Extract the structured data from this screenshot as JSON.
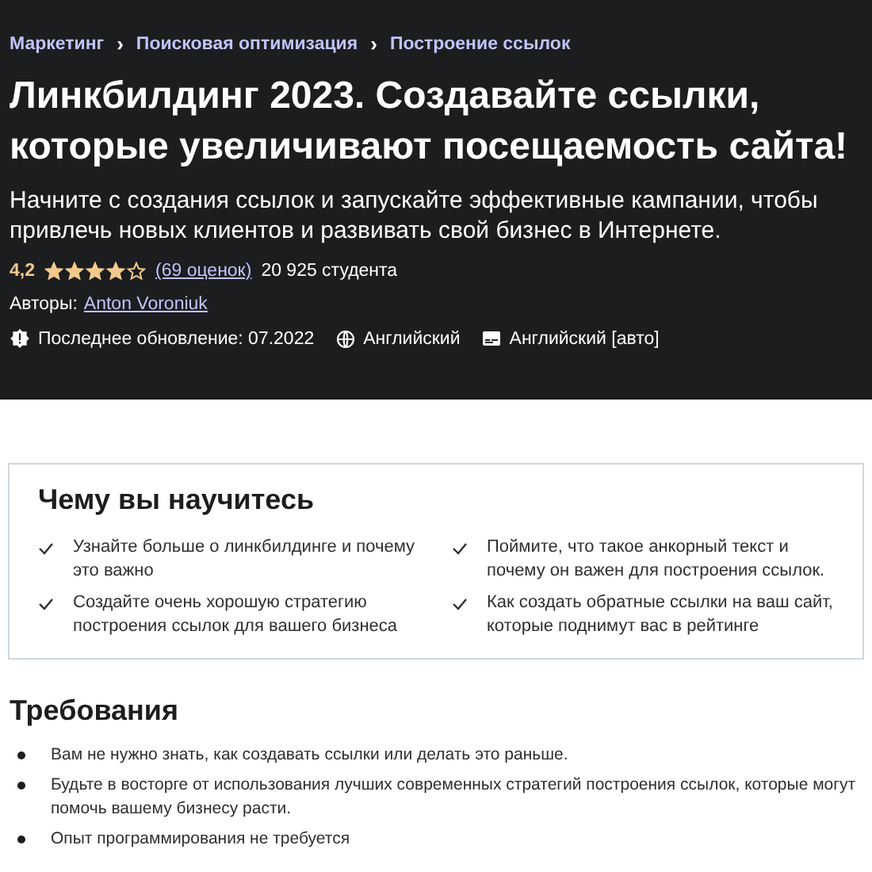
{
  "breadcrumbs": [
    {
      "label": "Маркетинг"
    },
    {
      "label": "Поисковая оптимизация"
    },
    {
      "label": "Построение ссылок"
    }
  ],
  "separator": "›",
  "title": "Линкбилдинг 2023. Создавайте ссылки, которые увеличивают посещаемость сайта!",
  "subtitle": "Начните с создания ссылок и запускайте эффективные кампании, чтобы привлечь новых клиентов и развивать свой бизнес в Интернете.",
  "rating": {
    "value": "4,2",
    "stars": 4,
    "reviews": "(69 оценок)",
    "students": "20 925 студента"
  },
  "authors": {
    "label": "Авторы:",
    "name": "Anton Voroniuk"
  },
  "meta": [
    {
      "kind": "updated",
      "text": "Последнее обновление: 07.2022"
    },
    {
      "kind": "language",
      "text": "Английский"
    },
    {
      "kind": "captions",
      "text": "Английский [авто]"
    }
  ],
  "learn": {
    "title": "Чему вы научитесь",
    "items": [
      "Узнайте больше о линкбилдинге и почему это важно",
      "Поймите, что такое анкорный текст и почему он важен для построения ссылок.",
      "Создайте очень хорошую стратегию построения ссылок для вашего бизнеса",
      "Как создать обратные ссылки на ваш сайт, которые поднимут вас в рейтинге"
    ]
  },
  "requirements": {
    "title": "Требования",
    "items": [
      "Вам не нужно знать, как создавать ссылки или делать это раньше.",
      "Будьте в восторге от использования лучших современных стратегий построения ссылок, которые могут помочь вашему бизнесу расти.",
      "Опыт программирования не требуется"
    ]
  }
}
